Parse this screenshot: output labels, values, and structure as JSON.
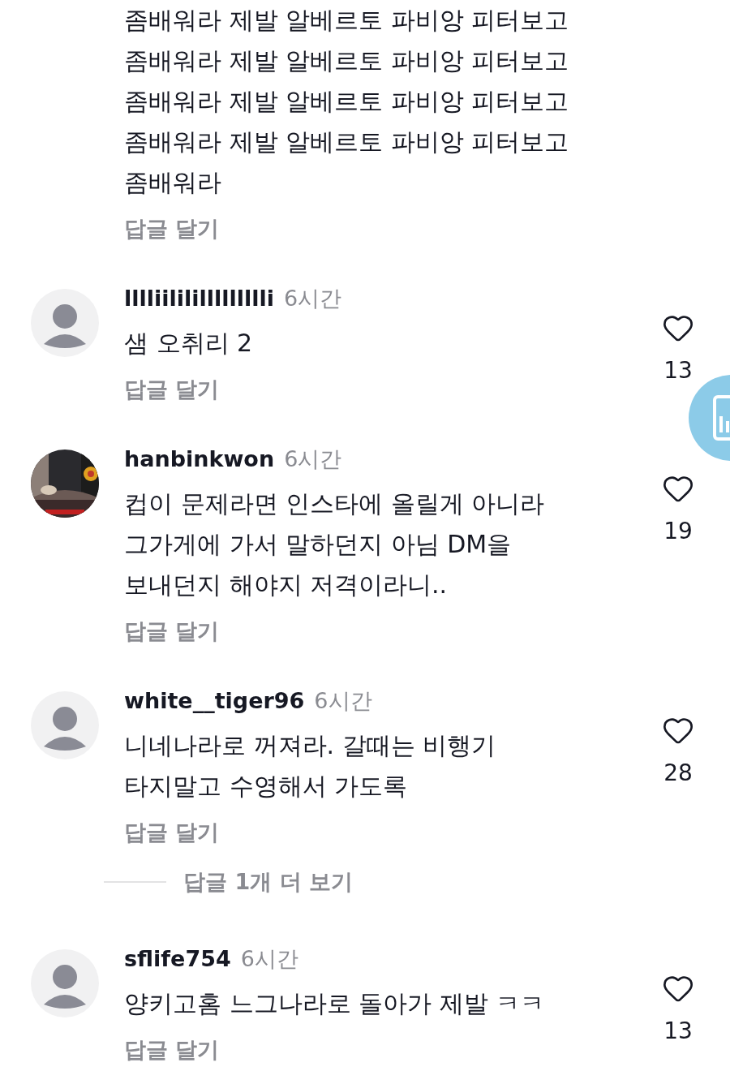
{
  "comments": [
    {
      "text": "좀배워라 제발 알베르토 파비앙 피터보고\n좀배워라 제발 알베르토 파비앙 피터보고\n좀배워라 제발 알베르토 파비앙 피터보고\n좀배워라 제발 알베르토 파비앙 피터보고\n좀배워라",
      "reply": "답글 달기"
    },
    {
      "kind": "default",
      "username": "lllliililillllllllli",
      "time": "6시간",
      "text": "샘 오취리 2",
      "reply": "답글 달기",
      "likes": "13"
    },
    {
      "kind": "picture",
      "username": "hanbinkwon",
      "time": "6시간",
      "text": "컵이 문제라면 인스타에 올릴게 아니라\n그가게에 가서 말하던지 아님 DM을\n보내던지 해야지 저격이라니..",
      "reply": "답글 달기",
      "likes": "19"
    },
    {
      "kind": "default",
      "username": "white__tiger96",
      "time": "6시간",
      "text": "니네나라로 꺼져라. 갈때는 비행기\n타지말고 수영해서 가도록",
      "reply": "답글 달기",
      "likes": "28",
      "more_replies": "답글 1개 더 보기"
    },
    {
      "kind": "default",
      "username": "sflife754",
      "time": "6시간",
      "text": "양키고홈 느그나라로 돌아가 제발 ㅋㅋ",
      "reply": "답글 달기",
      "likes": "13"
    }
  ]
}
